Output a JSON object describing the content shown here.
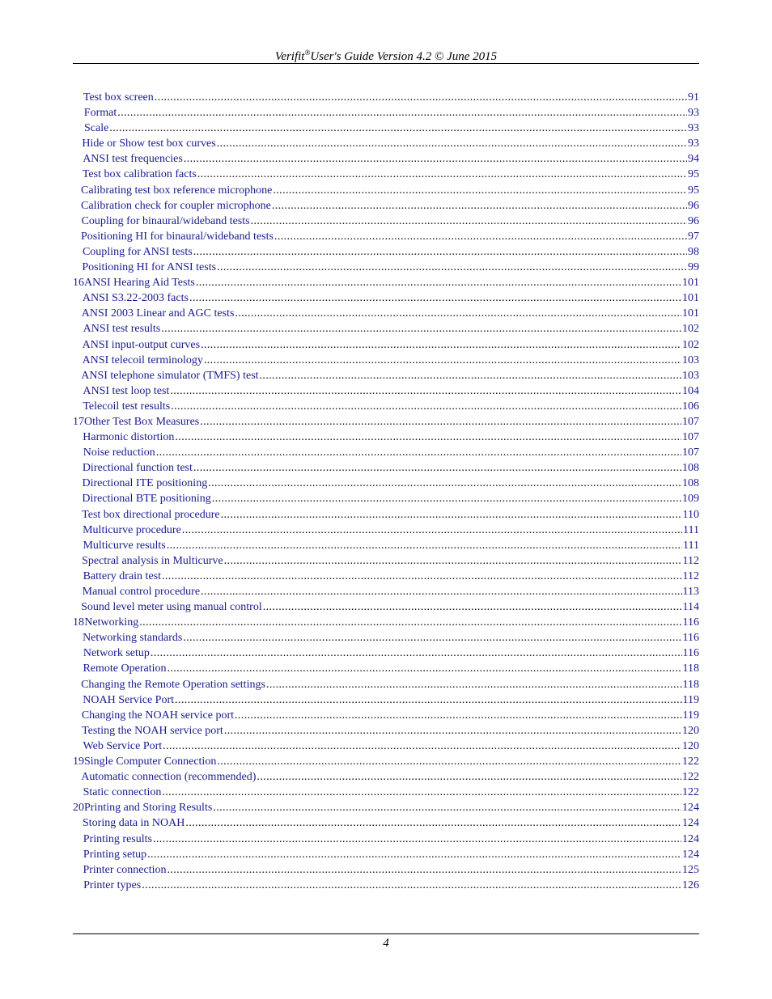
{
  "header": {
    "brand": "Verifit",
    "registered": "®",
    "rest": "User's Guide Version 4.2 © June 2015"
  },
  "toc": [
    {
      "num": "",
      "title": "Test box screen",
      "page": "91"
    },
    {
      "num": "",
      "title": "Format",
      "page": "93"
    },
    {
      "num": "",
      "title": "Scale",
      "page": "93"
    },
    {
      "num": "",
      "title": "Hide or Show test box curves",
      "page": "93"
    },
    {
      "num": "",
      "title": "ANSI test frequencies",
      "page": "94"
    },
    {
      "num": "",
      "title": "Test box calibration facts",
      "page": "95"
    },
    {
      "num": "",
      "title": "Calibrating test box reference microphone",
      "page": "95"
    },
    {
      "num": "",
      "title": "Calibration check for coupler microphone",
      "page": "96"
    },
    {
      "num": "",
      "title": "Coupling for binaural/wideband tests",
      "page": "96"
    },
    {
      "num": "",
      "title": "Positioning HI for binaural/wideband tests",
      "page": "97"
    },
    {
      "num": "",
      "title": "Coupling for ANSI tests",
      "page": "98"
    },
    {
      "num": "",
      "title": "Positioning HI for ANSI tests",
      "page": "99"
    },
    {
      "num": "16",
      "title": "ANSI Hearing Aid Tests",
      "page": "101"
    },
    {
      "num": "",
      "title": "ANSI S3.22-2003 facts",
      "page": "101"
    },
    {
      "num": "",
      "title": "ANSI 2003 Linear and AGC tests",
      "page": "101"
    },
    {
      "num": "",
      "title": "ANSI test results",
      "page": "102"
    },
    {
      "num": "",
      "title": "ANSI input-output curves",
      "page": "102"
    },
    {
      "num": "",
      "title": "ANSI telecoil terminology",
      "page": "103"
    },
    {
      "num": "",
      "title": "ANSI telephone simulator (TMFS) test",
      "page": "103"
    },
    {
      "num": "",
      "title": "ANSI test loop test",
      "page": "104"
    },
    {
      "num": "",
      "title": "Telecoil test results",
      "page": "106"
    },
    {
      "num": "17",
      "title": "Other Test Box Measures",
      "page": "107"
    },
    {
      "num": "",
      "title": "Harmonic distortion",
      "page": "107"
    },
    {
      "num": "",
      "title": "Noise reduction",
      "page": "107"
    },
    {
      "num": "",
      "title": "Directional function test",
      "page": "108"
    },
    {
      "num": "",
      "title": "Directional ITE positioning",
      "page": "108"
    },
    {
      "num": "",
      "title": "Directional BTE positioning",
      "page": "109"
    },
    {
      "num": "",
      "title": "Test box directional procedure",
      "page": "110"
    },
    {
      "num": "",
      "title": "Multicurve procedure",
      "page": "111"
    },
    {
      "num": "",
      "title": "Multicurve results",
      "page": "111"
    },
    {
      "num": "",
      "title": "Spectral analysis in Multicurve",
      "page": "112"
    },
    {
      "num": "",
      "title": "Battery drain test",
      "page": "112"
    },
    {
      "num": "",
      "title": "Manual control procedure",
      "page": "113"
    },
    {
      "num": "",
      "title": "Sound level meter using manual control",
      "page": "114"
    },
    {
      "num": "18",
      "title": "Networking",
      "page": "116"
    },
    {
      "num": "",
      "title": "Networking standards",
      "page": "116"
    },
    {
      "num": "",
      "title": "Network setup",
      "page": "116"
    },
    {
      "num": "",
      "title": "Remote Operation",
      "page": "118"
    },
    {
      "num": "",
      "title": "Changing the Remote Operation settings",
      "page": "118"
    },
    {
      "num": "",
      "title": "NOAH Service Port",
      "page": "119"
    },
    {
      "num": "",
      "title": "Changing the NOAH service port",
      "page": "119"
    },
    {
      "num": "",
      "title": "Testing the NOAH service port",
      "page": "120"
    },
    {
      "num": "",
      "title": "Web Service Port",
      "page": "120"
    },
    {
      "num": "19",
      "title": "Single Computer Connection",
      "page": "122"
    },
    {
      "num": "",
      "title": "Automatic connection (recommended)",
      "page": "122"
    },
    {
      "num": "",
      "title": "Static connection",
      "page": "122"
    },
    {
      "num": "20",
      "title": "Printing and Storing Results",
      "page": "124"
    },
    {
      "num": "",
      "title": "Storing data in NOAH",
      "page": "124"
    },
    {
      "num": "",
      "title": "Printing results",
      "page": "124"
    },
    {
      "num": "",
      "title": "Printing setup",
      "page": "124"
    },
    {
      "num": "",
      "title": "Printer connection",
      "page": "125"
    },
    {
      "num": "",
      "title": "Printer types",
      "page": "126"
    }
  ],
  "footer": {
    "page_number": "4"
  }
}
